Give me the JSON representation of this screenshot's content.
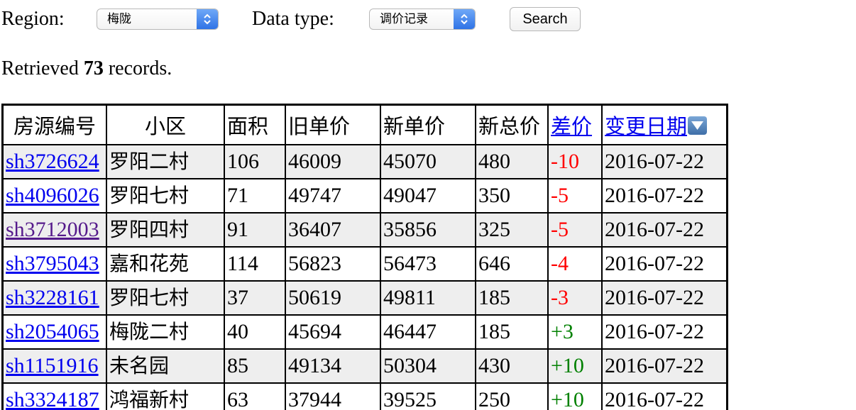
{
  "form": {
    "region_label": "Region:",
    "region_value": "梅陇",
    "datatype_label": "Data type:",
    "datatype_value": "调价记录",
    "search_label": "Search"
  },
  "summary": {
    "prefix": "Retrieved ",
    "count": "73",
    "suffix": " records."
  },
  "table": {
    "headers": {
      "id": "房源编号",
      "community": "小区",
      "area": "面积",
      "old_price": "旧单价",
      "new_price": "新单价",
      "new_total": "新总价",
      "diff": "差价",
      "date": "变更日期"
    },
    "rows": [
      {
        "id": "sh3726624",
        "community": "罗阳二村",
        "area": "106",
        "old_price": "46009",
        "new_price": "45070",
        "new_total": "480",
        "diff": "-10",
        "date": "2016-07-22"
      },
      {
        "id": "sh4096026",
        "community": "罗阳七村",
        "area": "71",
        "old_price": "49747",
        "new_price": "49047",
        "new_total": "350",
        "diff": "-5",
        "date": "2016-07-22"
      },
      {
        "id": "sh3712003",
        "community": "罗阳四村",
        "area": "91",
        "old_price": "36407",
        "new_price": "35856",
        "new_total": "325",
        "diff": "-5",
        "date": "2016-07-22"
      },
      {
        "id": "sh3795043",
        "community": "嘉和花苑",
        "area": "114",
        "old_price": "56823",
        "new_price": "56473",
        "new_total": "646",
        "diff": "-4",
        "date": "2016-07-22"
      },
      {
        "id": "sh3228161",
        "community": "罗阳七村",
        "area": "37",
        "old_price": "50619",
        "new_price": "49811",
        "new_total": "185",
        "diff": "-3",
        "date": "2016-07-22"
      },
      {
        "id": "sh2054065",
        "community": "梅陇二村",
        "area": "40",
        "old_price": "45694",
        "new_price": "46447",
        "new_total": "185",
        "diff": "+3",
        "date": "2016-07-22"
      },
      {
        "id": "sh1151916",
        "community": "未名园",
        "area": "85",
        "old_price": "49134",
        "new_price": "50304",
        "new_total": "430",
        "diff": "+10",
        "date": "2016-07-22"
      },
      {
        "id": "sh3324187",
        "community": "鸿福新村",
        "area": "63",
        "old_price": "37944",
        "new_price": "39525",
        "new_total": "250",
        "diff": "+10",
        "date": "2016-07-22"
      }
    ]
  },
  "colors": {
    "negative": "#ff0000",
    "positive": "#008000",
    "link": "#0000ee",
    "visited_link": "#551a8b",
    "alt_row": "#eeeeee"
  },
  "icons": {
    "select_stepper": "up-down-chevron-icon",
    "sort_indicator": "sort-descending-icon"
  }
}
